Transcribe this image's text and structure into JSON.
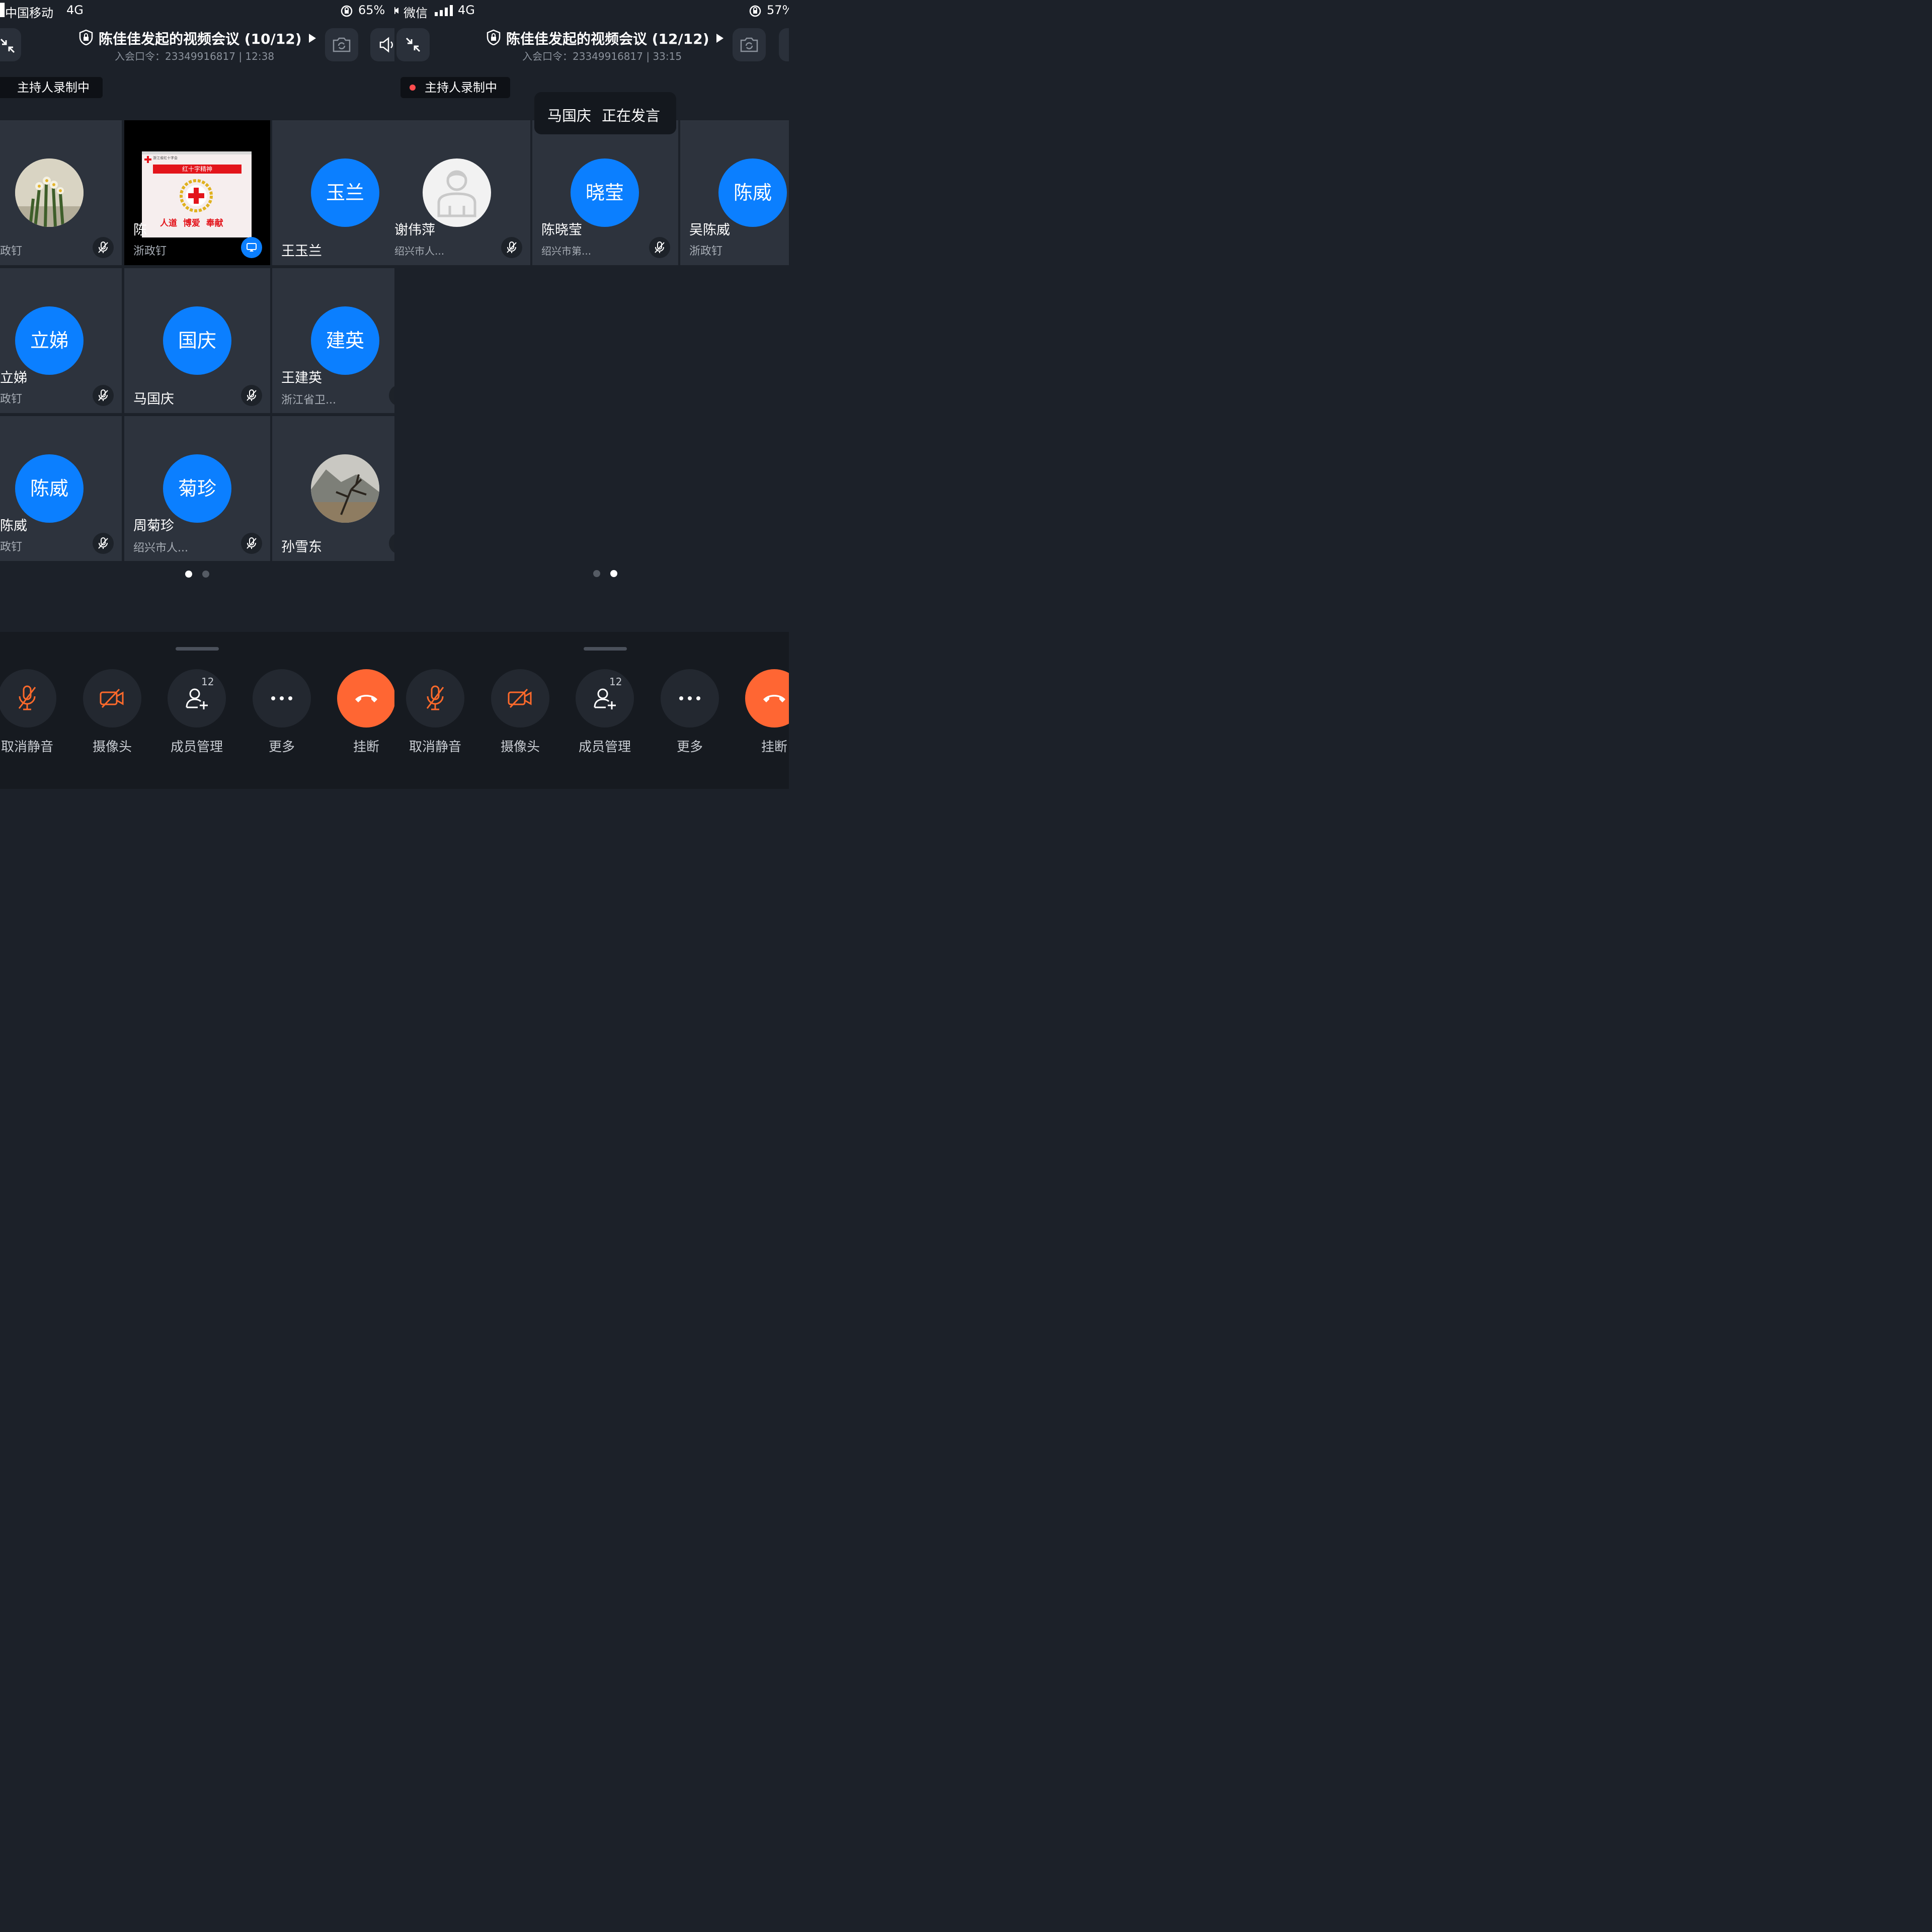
{
  "left": {
    "status": {
      "carrier": "中国移动",
      "network": "4G",
      "battery": "65%"
    },
    "header": {
      "title": "陈佳佳发起的视频会议 (10/12)",
      "passcode": "入会口令：23349916817 | 12:38"
    },
    "recording": "主持人录制中",
    "share_slide": {
      "banner": "红十字精神",
      "motto": "人道  博爱  奉献",
      "org_line": "浙江省红十字会"
    },
    "tiles": [
      {
        "name": "",
        "org": "政钉"
      },
      {
        "name": "陈",
        "org": "浙政钉"
      },
      {
        "avatar": "玉兰",
        "name": "王玉兰"
      },
      {
        "avatar": "立娣",
        "name": "立娣",
        "org": "政钉"
      },
      {
        "avatar": "国庆",
        "name": "马国庆"
      },
      {
        "avatar": "建英",
        "name": "王建英",
        "org": "浙江省卫..."
      },
      {
        "avatar": "陈威",
        "name": "陈威",
        "org": "政钉"
      },
      {
        "avatar": "菊珍",
        "name": "周菊珍",
        "org": "绍兴市人..."
      },
      {
        "name": "孙雪东"
      }
    ],
    "page_index": 1,
    "page_count": 2
  },
  "right": {
    "status": {
      "app": "微信",
      "network": "4G",
      "battery": "57%"
    },
    "header": {
      "title": "陈佳佳发起的视频会议 (12/12)",
      "passcode": "入会口令：23349916817 | 33:15"
    },
    "recording": "主持人录制中",
    "speaker": {
      "name": "马国庆",
      "status": "正在发言"
    },
    "tiles": [
      {
        "name": "谢伟萍",
        "org": "绍兴市人..."
      },
      {
        "avatar": "晓莹",
        "name": "陈晓莹",
        "org": "绍兴市第..."
      },
      {
        "avatar": "陈威",
        "name": "吴陈威",
        "org": "浙政钉"
      }
    ],
    "page_index": 2,
    "page_count": 2
  },
  "controls": {
    "unmute": "取消静音",
    "camera": "摄像头",
    "members": "成员管理",
    "members_count": "12",
    "more": "更多",
    "hangup": "挂断"
  },
  "colors": {
    "accent": "#0b7fff",
    "hangup": "#ff6633",
    "muted_icon": "#ff6a2b",
    "recording_dot": "#ff4d4f"
  }
}
